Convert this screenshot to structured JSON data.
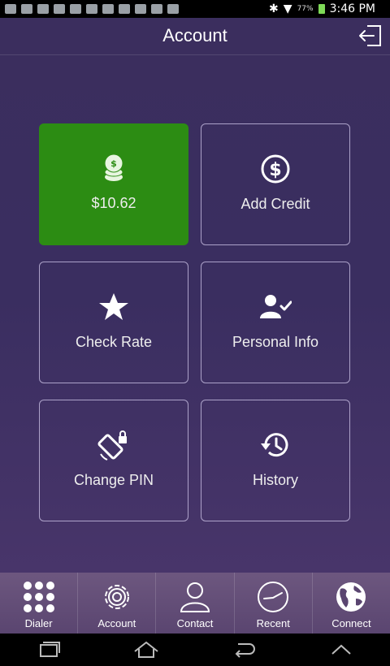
{
  "status_bar": {
    "time": "3:46 PM",
    "battery_pct": "77%"
  },
  "header": {
    "title": "Account"
  },
  "tiles": [
    {
      "label": "$10.62",
      "icon": "coins-icon"
    },
    {
      "label": "Add Credit",
      "icon": "dollar-circle-icon"
    },
    {
      "label": "Check Rate",
      "icon": "star-icon"
    },
    {
      "label": "Personal Info",
      "icon": "user-check-icon"
    },
    {
      "label": "Change PIN",
      "icon": "rotate-lock-icon"
    },
    {
      "label": "History",
      "icon": "history-icon"
    }
  ],
  "tabs": [
    {
      "label": "Dialer",
      "icon": "dialpad-icon"
    },
    {
      "label": "Account",
      "icon": "gear-icon"
    },
    {
      "label": "Contact",
      "icon": "person-icon"
    },
    {
      "label": "Recent",
      "icon": "clock-icon"
    },
    {
      "label": "Connect",
      "icon": "globe-icon"
    }
  ],
  "colors": {
    "background": "#3b2d5e",
    "balance_tile": "#2c8c13",
    "tabbar": "#6d577f"
  }
}
